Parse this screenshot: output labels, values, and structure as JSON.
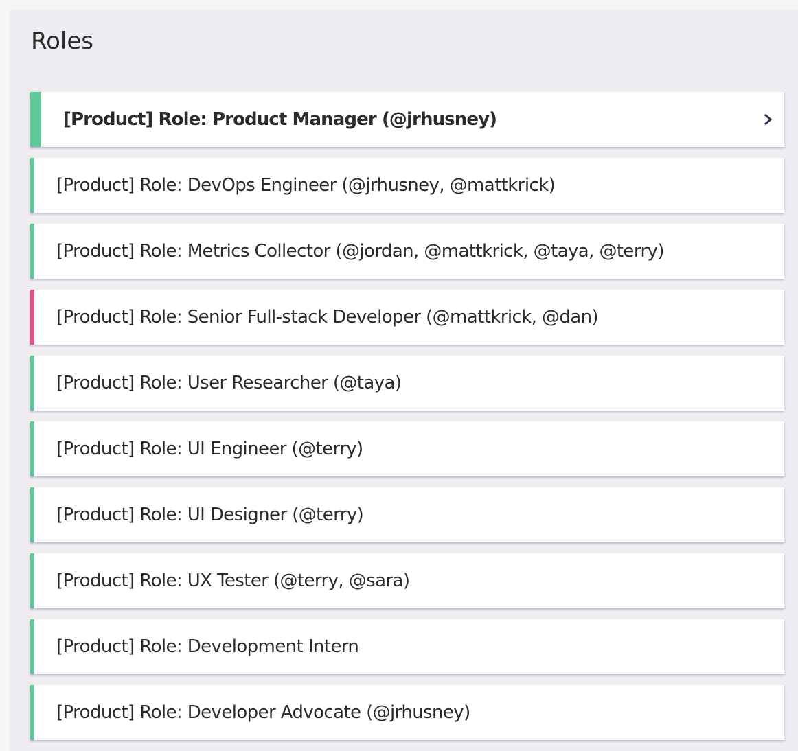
{
  "title": "Roles",
  "colors": {
    "green": "#5fc99a",
    "pink": "#e2507e",
    "chevron": "#3d2750"
  },
  "roles": [
    {
      "label": "[Product] Role: Product Manager (@jrhusney)",
      "color": "green",
      "active": true
    },
    {
      "label": "[Product] Role: DevOps Engineer (@jrhusney, @mattkrick)",
      "color": "green"
    },
    {
      "label": "[Product] Role: Metrics Collector (@jordan, @mattkrick, @taya, @terry)",
      "color": "green"
    },
    {
      "label": "[Product] Role: Senior Full-stack Developer (@mattkrick, @dan)",
      "color": "pink"
    },
    {
      "label": "[Product] Role: User Researcher (@taya)",
      "color": "green"
    },
    {
      "label": "[Product] Role: UI Engineer (@terry)",
      "color": "green"
    },
    {
      "label": "[Product] Role: UI Designer (@terry)",
      "color": "green"
    },
    {
      "label": "[Product] Role: UX Tester (@terry, @sara)",
      "color": "green"
    },
    {
      "label": "[Product] Role: Development Intern",
      "color": "green"
    },
    {
      "label": "[Product] Role: Developer Advocate (@jrhusney)",
      "color": "green"
    }
  ]
}
